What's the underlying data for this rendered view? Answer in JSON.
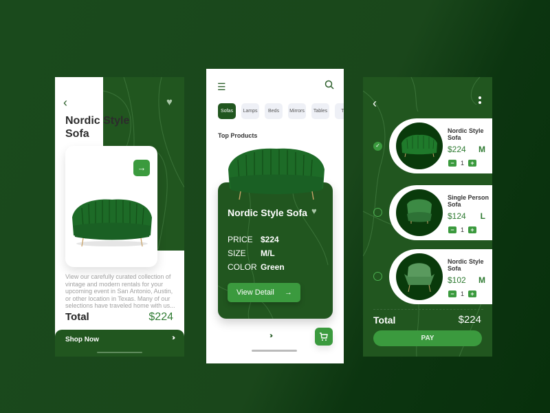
{
  "colors": {
    "brand_dark": "#21561f",
    "accent": "#3b9a3e",
    "price_green": "#2e7a31"
  },
  "detail_screen": {
    "title": "Nordic Style Sofa",
    "icons": {
      "back": "chevron-left-icon",
      "favorite": "heart-icon",
      "next": "arrow-right-icon"
    },
    "description": "View our carefully curated collection of vintage and modern rentals for your upcoming event in San Antonio, Austin, or other location in Texas. Many of our selections have traveled home with us...",
    "total_label": "Total",
    "total_value": "$224",
    "shop_now_label": "Shop Now",
    "shop_now_arrows": "›››"
  },
  "catalog_screen": {
    "icons": {
      "menu": "hamburger-menu-icon",
      "search": "search-icon",
      "cart": "cart-icon"
    },
    "categories": [
      {
        "label": "Sofas",
        "active": true
      },
      {
        "label": "Lamps",
        "active": false
      },
      {
        "label": "Beds",
        "active": false
      },
      {
        "label": "Mirrors",
        "active": false
      },
      {
        "label": "Tables",
        "active": false
      },
      {
        "label": "Te",
        "active": false
      }
    ],
    "section_title": "Top Products",
    "product": {
      "title": "Nordic Style Sofa",
      "price_label": "PRICE",
      "price_value": "$224",
      "size_label": "SIZE",
      "size_value": "M/L",
      "color_label": "COLOR",
      "color_value": "Green",
      "view_detail_label": "View Detail",
      "view_detail_arrow": "→"
    },
    "pager_arrows": "›››"
  },
  "cart_screen": {
    "icons": {
      "back": "chevron-left-icon",
      "more": "more-vertical-icon"
    },
    "items": [
      {
        "name": "Nordic Style Sofa",
        "price": "$224",
        "size": "M",
        "quantity": "1",
        "selected": true
      },
      {
        "name": "Single Person Sofa",
        "price": "$124",
        "size": "L",
        "quantity": "1",
        "selected": false
      },
      {
        "name": "Nordic Style Sofa",
        "price": "$102",
        "size": "M",
        "quantity": "1",
        "selected": false
      }
    ],
    "qty_minus": "−",
    "qty_plus": "+",
    "total_label": "Total",
    "total_value": "$224",
    "pay_label": "PAY"
  }
}
